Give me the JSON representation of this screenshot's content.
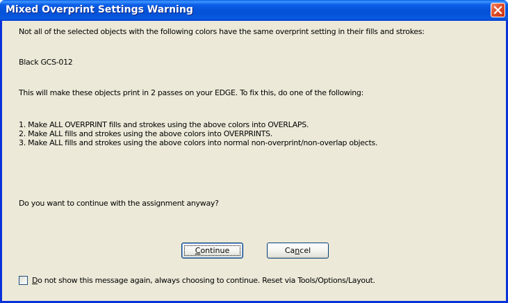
{
  "window": {
    "title": "Mixed Overprint Settings Warning",
    "close_icon": "close-icon"
  },
  "message": {
    "intro": "Not all of the selected objects with the following colors have the same overprint setting in their fills and strokes:",
    "color": "Black GCS-012",
    "warning": "This will make these objects print in 2 passes on your EDGE.  To fix this, do one of the following:",
    "options": [
      "1. Make ALL OVERPRINT fills and strokes using the above colors into OVERLAPS.",
      "2. Make ALL fills and strokes using the above colors into OVERPRINTS.",
      "3. Make ALL fills and strokes using the above colors into normal non-overprint/non-overlap objects."
    ],
    "question": "Do you want to continue with the assignment anyway?"
  },
  "buttons": {
    "continue_first": "C",
    "continue_rest": "ontinue",
    "cancel_pre": "Ca",
    "cancel_accel": "n",
    "cancel_rest": "cel"
  },
  "checkbox": {
    "label_accel": "D",
    "label_rest": "o not show this message again, always choosing to continue.  Reset via Tools/Options/Layout.",
    "checked": false
  },
  "colors": {
    "titlebar": "#0553d9",
    "client": "#ece9d8",
    "close": "#e0502b"
  }
}
